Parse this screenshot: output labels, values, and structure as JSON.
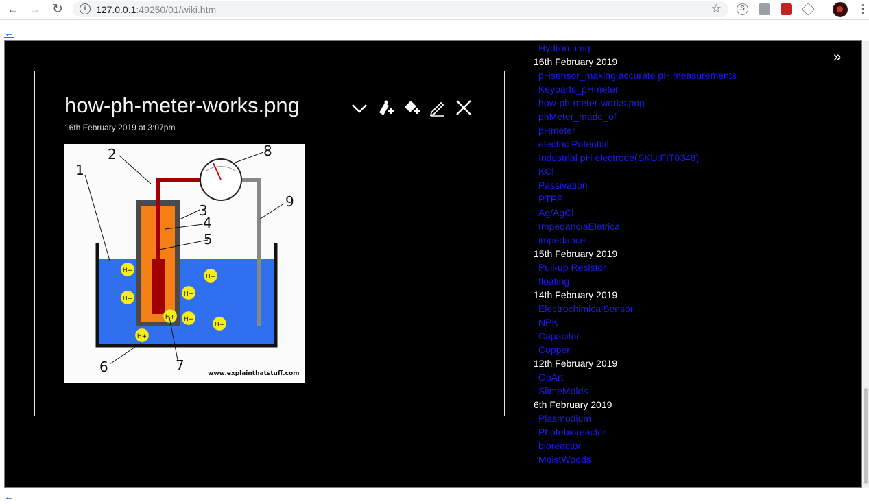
{
  "browser": {
    "url_host": "127.0.0.1",
    "url_rest": ":49250/01/wiki.htm",
    "back_icon": "←",
    "forward_icon": "→",
    "reload_icon": "↻",
    "star_icon": "☆",
    "info_icon": "i",
    "skype_icon": "S",
    "kebab_icon": "⋮"
  },
  "page": {
    "back_link": "←"
  },
  "tiddler": {
    "title": "how-ph-meter-works.png",
    "subtitle": "16th February 2019 at 3:07pm",
    "buttons": {
      "more": "⌄",
      "new_here": "✚",
      "new_journal": "✚",
      "edit": "✎",
      "close": "✕"
    },
    "image": {
      "labels": [
        "1",
        "2",
        "3",
        "4",
        "5",
        "6",
        "7",
        "8",
        "9"
      ],
      "ion_label": "H+",
      "credit": "www.explainthatstuff.com"
    }
  },
  "sidebar": {
    "collapse_icon": "»",
    "items": [
      {
        "type": "link",
        "text": "Hydron_img"
      },
      {
        "type": "date",
        "text": "16th February 2019"
      },
      {
        "type": "link",
        "text": "pHsensor_making accurate pH measurements"
      },
      {
        "type": "link",
        "text": "Keyparts_pHmeter"
      },
      {
        "type": "link",
        "text": "how-ph-meter-works.png"
      },
      {
        "type": "link",
        "text": "phMeter_made_of"
      },
      {
        "type": "link",
        "text": "pHmeter"
      },
      {
        "type": "link",
        "text": "electric Potential"
      },
      {
        "type": "link",
        "text": "Industrial pH electrode(SKU:FIT0348)"
      },
      {
        "type": "link",
        "text": "KCl"
      },
      {
        "type": "link",
        "text": "Passivation"
      },
      {
        "type": "link",
        "text": "PTFE"
      },
      {
        "type": "link",
        "text": "Ag/AgCl"
      },
      {
        "type": "link",
        "text": "ImpedanciaEletrica"
      },
      {
        "type": "link",
        "text": "impedance"
      },
      {
        "type": "date",
        "text": "15th February 2019"
      },
      {
        "type": "link",
        "text": "Pull-up Resistor"
      },
      {
        "type": "link",
        "text": "floating"
      },
      {
        "type": "date",
        "text": "14th February 2019"
      },
      {
        "type": "link",
        "text": "ElectrochimicalSensor"
      },
      {
        "type": "link",
        "text": "NPK"
      },
      {
        "type": "link",
        "text": "Capacitor"
      },
      {
        "type": "link",
        "text": "Copper"
      },
      {
        "type": "date",
        "text": "12th February 2019"
      },
      {
        "type": "link",
        "text": "OpArt"
      },
      {
        "type": "link",
        "text": "SlimeMolds"
      },
      {
        "type": "date",
        "text": "6th February 2019"
      },
      {
        "type": "link",
        "text": "Plasmodium"
      },
      {
        "type": "link",
        "text": "Photobioreactor"
      },
      {
        "type": "link",
        "text": "bioreactor"
      },
      {
        "type": "link",
        "text": "MoistWoods"
      }
    ]
  },
  "colors": {
    "wiki_bg": "#000000",
    "link": "#1a1af0",
    "text": "#ffffff"
  }
}
